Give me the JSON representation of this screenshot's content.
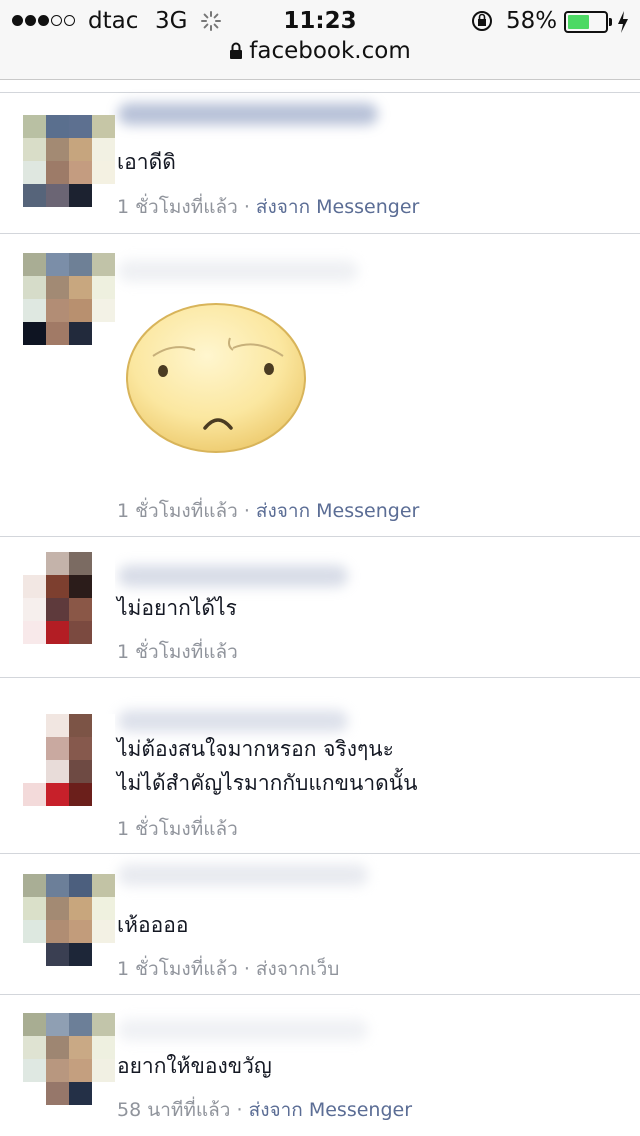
{
  "status_bar": {
    "carrier": "dtac",
    "network": "3G",
    "time": "11:23",
    "battery_percent": "58%",
    "battery_level": 0.58,
    "signal_bars_filled": 3,
    "signal_bars_total": 5
  },
  "browser": {
    "url": "facebook.com"
  },
  "colors": {
    "link": "#5b6d95",
    "meta": "#90949c",
    "battery": "#4cd964"
  },
  "messages": [
    {
      "text": "เอาดีดิ",
      "time": "1 ชั่วโมงที่แล้ว",
      "sep": " · ",
      "source_label": "ส่งจาก",
      "source": "Messenger"
    },
    {
      "sticker": "sad-face-sticker",
      "time": "1 ชั่วโมงที่แล้ว",
      "sep": " · ",
      "source_label": "ส่งจาก",
      "source": "Messenger"
    },
    {
      "text": "ไม่อยากได้ไร",
      "time": "1 ชั่วโมงที่แล้ว"
    },
    {
      "text_line1": "ไม่ต้องสนใจมากหรอก จริงๆนะ",
      "text_line2": "ไม่ได้สำคัญไรมากกับแกขนาดนั้น",
      "time": "1 ชั่วโมงที่แล้ว"
    },
    {
      "text": "เห้ออออ",
      "time": "1 ชั่วโมงที่แล้ว",
      "sep": " · ",
      "source_label": "ส่งจากเว็บ"
    },
    {
      "text": "อยากให้ของขวัญ",
      "time": "58 นาทีที่แล้ว",
      "sep": " · ",
      "source_label": "ส่งจาก",
      "source": "Messenger"
    }
  ]
}
